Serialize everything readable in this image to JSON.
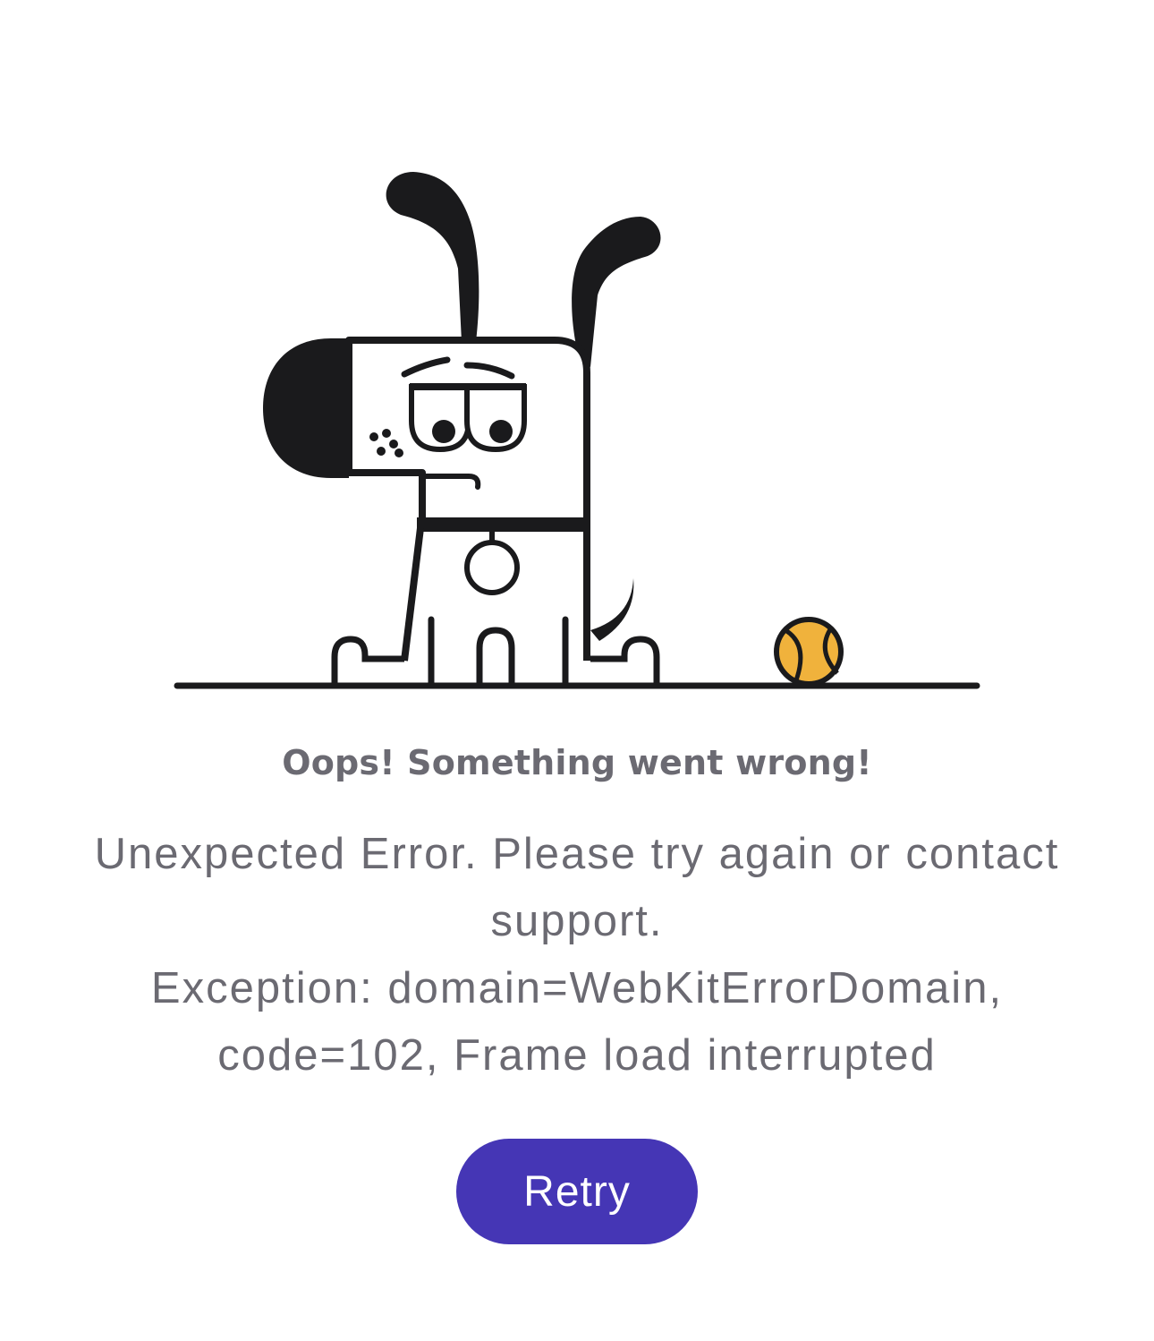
{
  "error": {
    "title": "Oops! Something went wrong!",
    "message_line1": "Unexpected Error. Please try again or contact support.",
    "message_line2": "Exception: domain=WebKitErrorDomain, code=102, Frame load interrupted"
  },
  "actions": {
    "retry_label": "Retry"
  },
  "colors": {
    "accent": "#4536b5",
    "text": "#6b6a72",
    "ball": "#f0b23c",
    "ink": "#1a1a1c"
  },
  "icons": {
    "illustration": "sad-dog-with-ball"
  }
}
